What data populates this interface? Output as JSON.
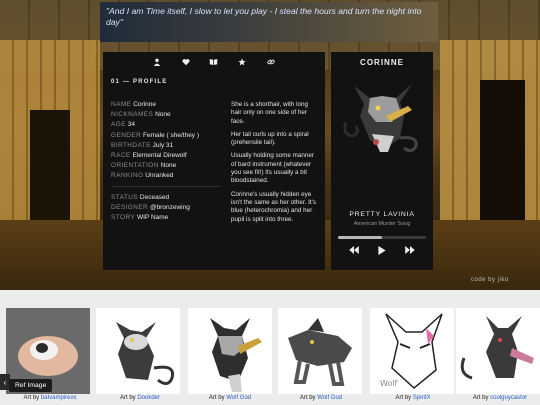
{
  "quote": "\"And I am Time itself, I slow to let you play - I steal the hours and turn the night into day\"",
  "tabs": [
    {
      "icon": "user-icon",
      "glyph": "👤"
    },
    {
      "icon": "heart-icon",
      "glyph": "♥"
    },
    {
      "icon": "book-icon",
      "glyph": "📖"
    },
    {
      "icon": "star-icon",
      "glyph": "★"
    },
    {
      "icon": "link-icon",
      "glyph": "🔗"
    }
  ],
  "profile": {
    "section_title": "01 — PROFILE",
    "stats_a": [
      {
        "key": "NAME",
        "value": "Corinne"
      },
      {
        "key": "NICKNAMES",
        "value": "None"
      },
      {
        "key": "AGE",
        "value": "34"
      },
      {
        "key": "GENDER",
        "value": "Female ( she/they )"
      },
      {
        "key": "BIRTHDATE",
        "value": "July 31"
      },
      {
        "key": "RACE",
        "value": "Elemental Direwolf"
      },
      {
        "key": "ORIENTATION",
        "value": "None"
      },
      {
        "key": "RANKING",
        "value": "Unranked"
      }
    ],
    "stats_b": [
      {
        "key": "STATUS",
        "value": "Deceased"
      },
      {
        "key": "DESIGNER",
        "value": "@bronzewing"
      },
      {
        "key": "STORY",
        "value": "WIP Name"
      }
    ],
    "bio": [
      "She is a shorthair, with long hair only on one side of her face.",
      "Her tail curls up into a spiral (prehensile tail).",
      "Usually holding some manner of bard instrument (whatever you see fit!) Its usually a bit bloodstained.",
      "Corinne's usually hidden eye isn't the same as her other. It's blue (heterochromia) and her pupil is split into three."
    ]
  },
  "player": {
    "name": "CORINNE",
    "song": "PRETTY LAVINIA",
    "artist": "American Murder Song",
    "progress": 0.5,
    "controls": [
      "prev-icon",
      "play-icon",
      "next-icon"
    ]
  },
  "credit": "code by jiko",
  "gallery": {
    "ref_label": "Ref Image",
    "items": [
      {
        "prefix": "Art by ",
        "artist": "batvampirexx"
      },
      {
        "prefix": "Art by ",
        "artist": "Dookder"
      },
      {
        "prefix": "Art by ",
        "artist": "Wolf God"
      },
      {
        "prefix": "Art by ",
        "artist": "Wolf God"
      },
      {
        "prefix": "Art by ",
        "artist": "SpiritX"
      },
      {
        "prefix": "Art by ",
        "artist": "coolguycastor"
      }
    ]
  },
  "colors": {
    "panel": "#121212",
    "link": "#2a5fc2",
    "quote_text": "#d8e4ff"
  }
}
